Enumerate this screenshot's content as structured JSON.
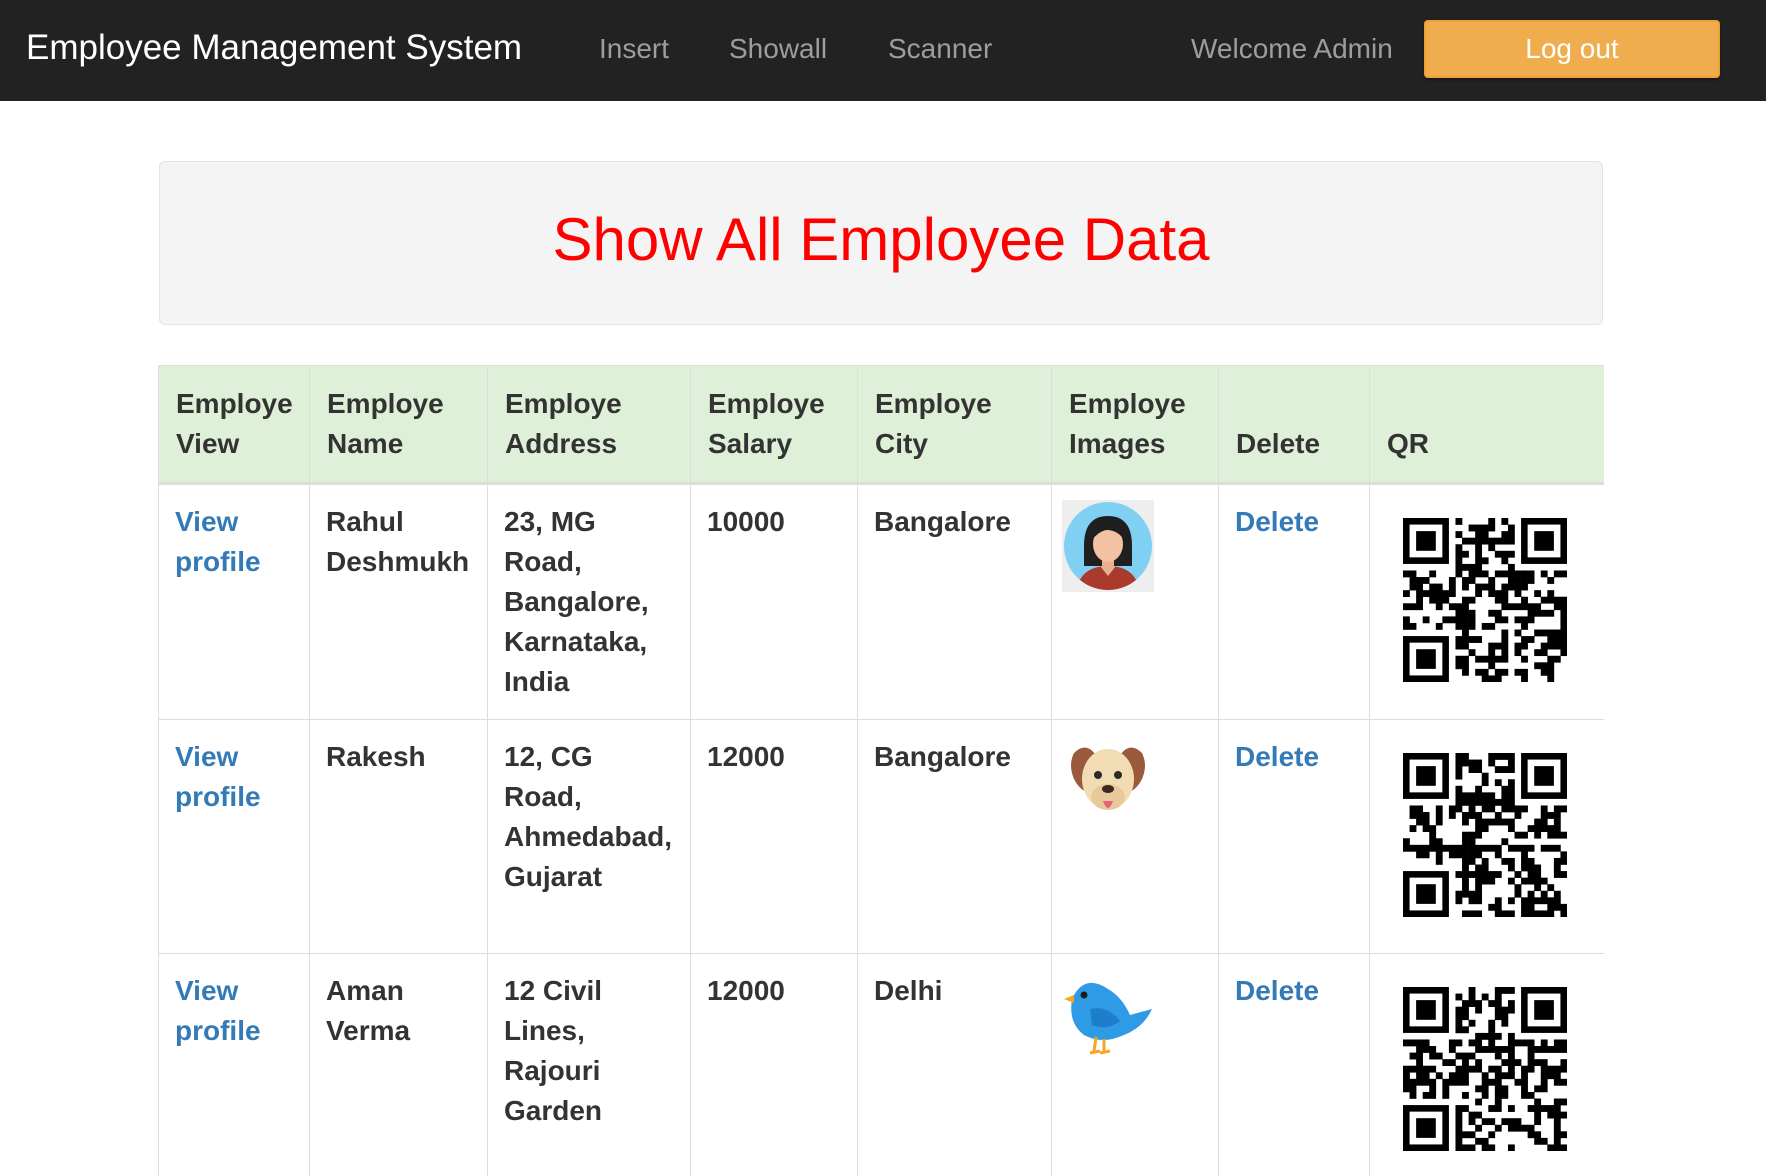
{
  "navbar": {
    "brand": "Employee Management System",
    "links": [
      "Insert",
      "Showall",
      "Scanner"
    ],
    "welcome": "Welcome Admin",
    "logout_label": "Log out",
    "logout_color": "#f0ad4e"
  },
  "heading": {
    "title": "Show All Employee Data",
    "title_color": "#ff0000"
  },
  "table": {
    "header_bg": "#dff0d8",
    "headers": [
      [
        "Employe",
        "View"
      ],
      [
        "Employe",
        "Name"
      ],
      [
        "Employe",
        "Address"
      ],
      [
        "Employe",
        "Salary"
      ],
      [
        "Employe",
        "City"
      ],
      [
        "Employe",
        "Images"
      ],
      [
        "Delete"
      ],
      [
        "QR"
      ]
    ],
    "rows": [
      {
        "view": [
          "View",
          "profile"
        ],
        "name": [
          "Rahul",
          "Deshmukh"
        ],
        "address": [
          "23, MG",
          "Road,",
          "Bangalore,",
          "Karnataka,",
          "India"
        ],
        "salary": "10000",
        "city": "Bangalore",
        "image_icon": "woman-avatar-icon",
        "delete": "Delete",
        "qr_icon": "qr-code-icon"
      },
      {
        "view": [
          "View",
          "profile"
        ],
        "name": [
          "Rakesh"
        ],
        "address": [
          "12, CG",
          "Road,",
          "Ahmedabad,",
          "Gujarat"
        ],
        "salary": "12000",
        "city": "Bangalore",
        "image_icon": "dog-icon",
        "delete": "Delete",
        "qr_icon": "qr-code-icon"
      },
      {
        "view": [
          "View",
          "profile"
        ],
        "name": [
          "Aman",
          "Verma"
        ],
        "address": [
          "12 Civil",
          "Lines,",
          "Rajouri",
          "Garden"
        ],
        "salary": "12000",
        "city": "Delhi",
        "image_icon": "blue-bird-icon",
        "delete": "Delete",
        "qr_icon": "qr-code-icon"
      }
    ]
  }
}
